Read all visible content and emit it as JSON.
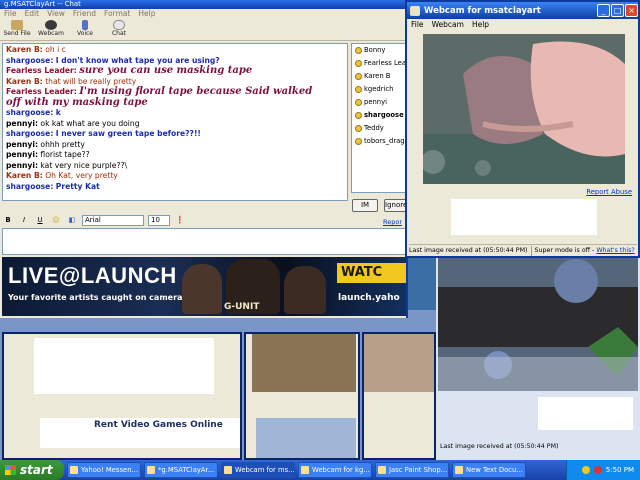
{
  "chat": {
    "title": "g.MSATClayArt -- Chat",
    "menu": [
      "File",
      "Edit",
      "View",
      "Friend",
      "Format",
      "Help"
    ],
    "toolbar": [
      "Send File",
      "Webcam",
      "Voice",
      "Chat"
    ],
    "messages": [
      {
        "from": "Karen B:",
        "text": "oh i c",
        "who": "karen"
      },
      {
        "from": "shargoose:",
        "text": "I don't know what tape you are using?",
        "who": "shar"
      },
      {
        "from": "Fearless Leader:",
        "text": "sure you can use masking tape",
        "who": "fl"
      },
      {
        "from": "Karen B:",
        "text": "that will be really pretty",
        "who": "karen"
      },
      {
        "from": "Fearless Leader:",
        "text": "I'm using floral tape because Said walked",
        "who": "fl"
      },
      {
        "from": "",
        "text": " off with my masking tape",
        "who": "fl"
      },
      {
        "from": "shargoose:",
        "text": "k",
        "who": "shar"
      },
      {
        "from": "pennyi:",
        "text": "ok kat what are you doing",
        "who": "pen"
      },
      {
        "from": "shargoose:",
        "text": "I never saw green tape before??!!",
        "who": "shar"
      },
      {
        "from": "pennyi:",
        "text": "ohhh pretty",
        "who": "pen"
      },
      {
        "from": "pennyi:",
        "text": "florist tape??",
        "who": "pen"
      },
      {
        "from": "pennyi:",
        "text": "kat very nice purple??\\",
        "who": "pen"
      },
      {
        "from": "Karen B:",
        "text": "Oh Kat, very pretty",
        "who": "karen"
      },
      {
        "from": "shargoose:",
        "text": "Pretty Kat",
        "who": "shar"
      }
    ],
    "buddies": [
      {
        "name": "Bonny",
        "bold": false
      },
      {
        "name": "Fearless Lead",
        "bold": false
      },
      {
        "name": "Karen B",
        "bold": false
      },
      {
        "name": "kgedrich",
        "bold": false
      },
      {
        "name": "pennyi",
        "bold": false
      },
      {
        "name": "shargoose",
        "bold": true
      },
      {
        "name": "Teddy",
        "bold": false
      },
      {
        "name": "tobors_dragon",
        "bold": false
      }
    ],
    "im_label": "IM",
    "ignore_label": "Ignore",
    "format": {
      "bold": "B",
      "italic": "I",
      "underline": "U",
      "font": "Arial",
      "size": "10"
    },
    "report_label": "Repor",
    "input_value": ""
  },
  "banner": {
    "headline": "LIVE@LAUNCH",
    "subline": "Your favorite artists caught on camera",
    "artist": "G-UNIT",
    "watch": "WATC",
    "site": "launch.yaho"
  },
  "webcam": {
    "title": "Webcam for msatclayart",
    "menu": [
      "File",
      "Webcam",
      "Help"
    ],
    "report_abuse": "Report Abuse",
    "status_time": "Last image received at (05:50:44 PM)",
    "super_mode": "Super mode is off -",
    "whats_this": "What's this?"
  },
  "webcam2": {
    "status_time": "Last image received at (05:50:44 PM)"
  },
  "taskbar": {
    "start": "start",
    "tasks": [
      {
        "label": "Yahoo! Messen...",
        "active": false
      },
      {
        "label": "*g.MSATClayAr...",
        "active": false
      },
      {
        "label": "Webcam for ms...",
        "active": true
      },
      {
        "label": "Webcam for kg...",
        "active": false
      },
      {
        "label": "Jasc Paint Shop...",
        "active": false
      },
      {
        "label": "New Text Docu...",
        "active": false
      }
    ],
    "clock": "5:50 PM"
  },
  "colors": {
    "xp_blue": "#0b3a9c",
    "taskbar": "#245edb",
    "start_green": "#3c9a3a",
    "karen": "#a03010",
    "shargoose": "#1a2cad",
    "fearless": "#7a1040"
  }
}
